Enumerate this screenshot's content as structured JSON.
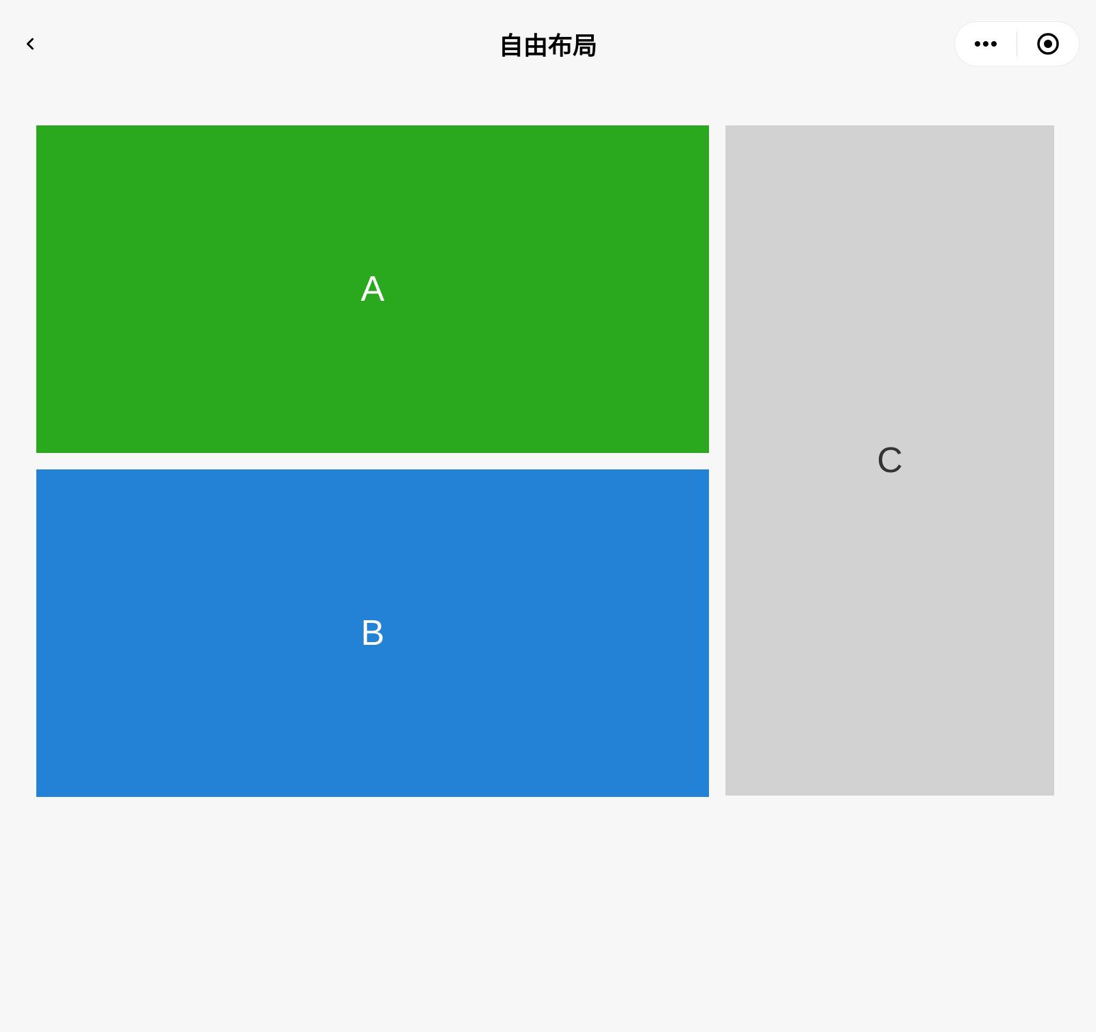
{
  "header": {
    "title": "自由布局"
  },
  "panels": {
    "a": {
      "label": "A"
    },
    "b": {
      "label": "B"
    },
    "c": {
      "label": "C"
    }
  },
  "colors": {
    "panel_a": "#2aa91f",
    "panel_b": "#2381d6",
    "panel_c": "#d3d2d3",
    "background": "#f7f7f7"
  }
}
